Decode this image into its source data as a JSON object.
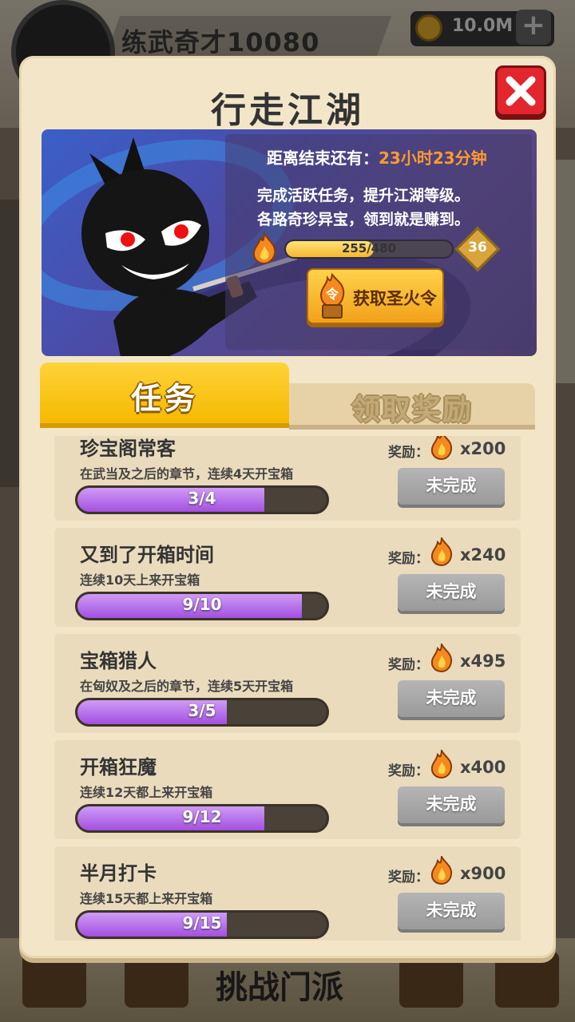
{
  "background": {
    "player_name": "练武奇才10080",
    "coins": "10.0M",
    "bottom_label": "挑战门派"
  },
  "modal": {
    "title": "行走江湖"
  },
  "banner": {
    "countdown_prefix": "距离结束还有：",
    "countdown_time": "23小时23分钟",
    "desc_line1": "完成活跃任务，提升江湖等级。",
    "desc_line2": "各路奇珍异宝，领到就是赚到。",
    "level_progress": "255/480",
    "level_progress_fraction": 0.53,
    "level": "36",
    "fire_token_button": "获取圣火令",
    "fire_token_glyph": "令"
  },
  "tabs": {
    "tasks": "任务",
    "claim_rewards": "领取奖励"
  },
  "tasks": [
    {
      "title": "珍宝阁常客",
      "desc": "在武当及之后的章节，连续4天开宝箱",
      "progress": "3/4",
      "fraction": 0.75,
      "reward_label": "奖励：",
      "reward": "x200",
      "status": "未完成"
    },
    {
      "title": "又到了开箱时间",
      "desc": "连续10天上来开宝箱",
      "progress": "9/10",
      "fraction": 0.9,
      "reward_label": "奖励：",
      "reward": "x240",
      "status": "未完成"
    },
    {
      "title": "宝箱猎人",
      "desc": "在匈奴及之后的章节，连续5天开宝箱",
      "progress": "3/5",
      "fraction": 0.6,
      "reward_label": "奖励：",
      "reward": "x495",
      "status": "未完成"
    },
    {
      "title": "开箱狂魔",
      "desc": "连续12天都上来开宝箱",
      "progress": "9/12",
      "fraction": 0.75,
      "reward_label": "奖励：",
      "reward": "x400",
      "status": "未完成"
    },
    {
      "title": "半月打卡",
      "desc": "连续15天都上来开宝箱",
      "progress": "9/15",
      "fraction": 0.6,
      "reward_label": "奖励：",
      "reward": "x900",
      "status": "未完成"
    }
  ],
  "colors": {
    "accent_orange": "#ff9a2e",
    "tab_yellow": "#f5b900",
    "progress_purple": "#a34fe0",
    "close_red": "#e3262e"
  }
}
